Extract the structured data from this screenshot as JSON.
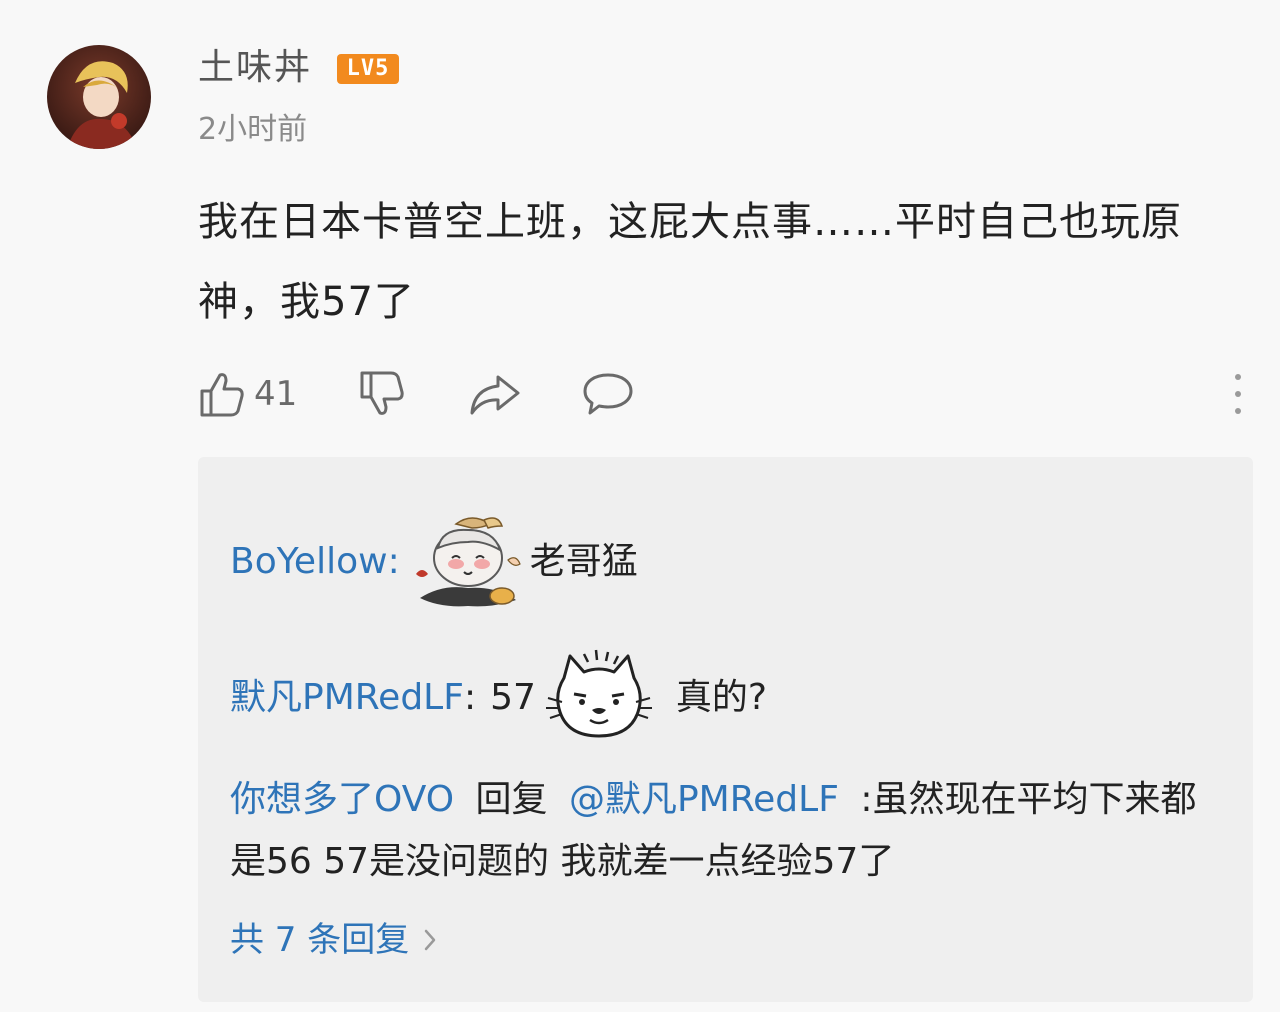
{
  "comment": {
    "username": "土味丼",
    "level_badge": "LV5",
    "timestamp": "2小时前",
    "text": "我在日本卡普空上班，这屁大点事……平时自己也玩原神，我57了"
  },
  "actions": {
    "like_count": "41",
    "icons": [
      "thumbs-up-icon",
      "thumbs-down-icon",
      "share-icon",
      "comment-icon",
      "more-icon"
    ]
  },
  "replies": [
    {
      "author": "BoYellow",
      "separator": ":",
      "sticker": "paimon-sticker",
      "text": "老哥猛"
    },
    {
      "author": "默凡PMRedLF",
      "separator": ":",
      "text_before": "57",
      "sticker": "cat-face-sticker",
      "text": "真的?"
    },
    {
      "author": "你想多了OVO",
      "reply_word": "回复",
      "mention": "@默凡PMRedLF",
      "text": ":虽然现在平均下来都是56 57是没问题的 我就差一点经验57了"
    }
  ],
  "more_replies_label": "共 7 条回复",
  "colors": {
    "link_blue": "#2e74b8",
    "badge_orange": "#f28a1e",
    "panel_bg": "#efefef",
    "page_bg": "#f8f8f8"
  }
}
